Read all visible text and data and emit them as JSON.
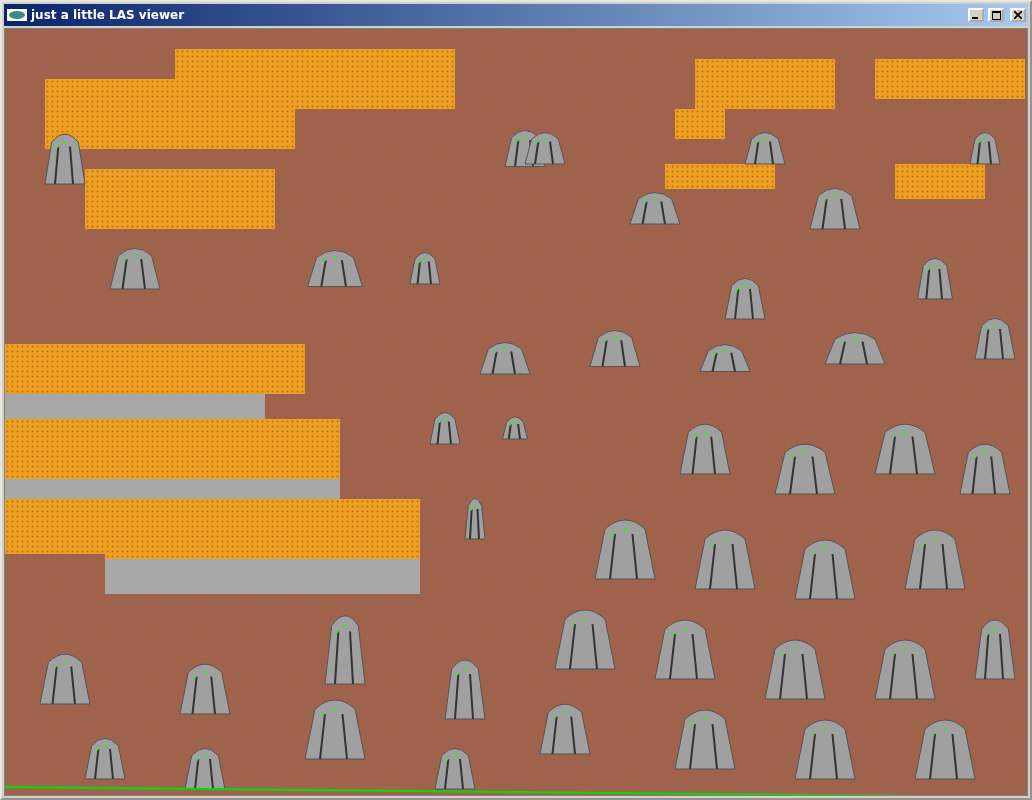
{
  "window": {
    "title": "just a little LAS viewer"
  }
}
